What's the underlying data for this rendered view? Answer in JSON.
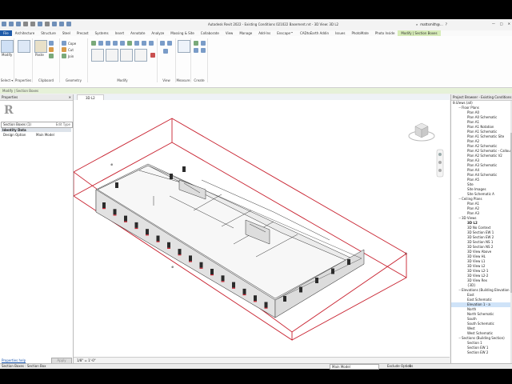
{
  "app": {
    "title": "Autodesk Revit 2022 - Existing Conditions 021022 Basement.rvt - 3D View: 3D L2",
    "user": "mattsmith@..."
  },
  "ribbon": {
    "tabs": [
      "File",
      "Architecture",
      "Structure",
      "Steel",
      "Precast",
      "Systems",
      "Insert",
      "Annotate",
      "Analyze",
      "Massing & Site",
      "Collaborate",
      "View",
      "Manage",
      "Add-Ins",
      "Enscape™",
      "CADtoEarth Addin",
      "Issues",
      "PhotoMate",
      "Photo Inside",
      "Modify | Section Boxes"
    ],
    "panels": {
      "select": {
        "button": "Modify",
        "label": "Select ▾"
      },
      "properties": {
        "label": "Properties"
      },
      "clipboard": {
        "paste": "Paste",
        "items": [
          "Cut",
          "Join"
        ],
        "label": "Clipboard"
      },
      "geometry": {
        "items": [
          "Cope",
          "Cut",
          "Join"
        ],
        "label": "Geometry"
      },
      "modify": {
        "label": "Modify"
      },
      "view": {
        "label": "View"
      },
      "measure": {
        "label": "Measure"
      },
      "create": {
        "label": "Create"
      }
    },
    "context_label": "Modify | Section Boxes"
  },
  "properties": {
    "header": "Properties",
    "type_selector": "Section Boxes (1)",
    "edit_type": "Edit Type",
    "group": "Identity Data",
    "rows": [
      {
        "key": "Design Option",
        "value": "Main Model"
      }
    ],
    "help_link": "Properties help",
    "apply": "Apply"
  },
  "view": {
    "tab": "3D L2",
    "scale": "1/8\" = 1'-0\""
  },
  "browser": {
    "header": "Project Browser - Existing Conditions 0...",
    "items": [
      {
        "label": "Views (all)",
        "level": 0,
        "exp": "−"
      },
      {
        "label": "Floor Plans",
        "level": 1,
        "exp": "−"
      },
      {
        "label": "Plan A0",
        "level": 2
      },
      {
        "label": "Plan A0 Schematic",
        "level": 2
      },
      {
        "label": "Plan A1",
        "level": 2
      },
      {
        "label": "Plan A1 Notation",
        "level": 2
      },
      {
        "label": "Plan A1 Schematic",
        "level": 2
      },
      {
        "label": "Plan A1 Schematic Site",
        "level": 2
      },
      {
        "label": "Plan A2",
        "level": 2
      },
      {
        "label": "Plan A2 Schematic",
        "level": 2
      },
      {
        "label": "Plan A2 Schematic - Callou",
        "level": 2
      },
      {
        "label": "Plan A2 Schematic V2",
        "level": 2
      },
      {
        "label": "Plan A3",
        "level": 2
      },
      {
        "label": "Plan A3 Schematic",
        "level": 2
      },
      {
        "label": "Plan A4",
        "level": 2
      },
      {
        "label": "Plan A4 Schematic",
        "level": 2
      },
      {
        "label": "Plan A5",
        "level": 2
      },
      {
        "label": "Site",
        "level": 2
      },
      {
        "label": "Site Images",
        "level": 2
      },
      {
        "label": "Site Schematic A",
        "level": 2
      },
      {
        "label": "Ceiling Plans",
        "level": 1,
        "exp": "−"
      },
      {
        "label": "Plan A1",
        "level": 2
      },
      {
        "label": "Plan A2",
        "level": 2
      },
      {
        "label": "Plan A3",
        "level": 2
      },
      {
        "label": "3D Views",
        "level": 1,
        "exp": "−"
      },
      {
        "label": "3D L2",
        "level": 2,
        "bold": true
      },
      {
        "label": "3D No Context",
        "level": 2
      },
      {
        "label": "3D Section EW 1",
        "level": 2
      },
      {
        "label": "3D Section EW 2",
        "level": 2
      },
      {
        "label": "3D Section NS 1",
        "level": 2
      },
      {
        "label": "3D Section NS 2",
        "level": 2
      },
      {
        "label": "3D View Above",
        "level": 2
      },
      {
        "label": "3D View HL",
        "level": 2
      },
      {
        "label": "3D View L1",
        "level": 2
      },
      {
        "label": "3D View L2",
        "level": 2
      },
      {
        "label": "3D View L2-1",
        "level": 2
      },
      {
        "label": "3D View L2-2",
        "level": 2
      },
      {
        "label": "3D View Rex",
        "level": 2
      },
      {
        "label": "{3D}",
        "level": 2
      },
      {
        "label": "Elevations (Building Elevation C",
        "level": 1,
        "exp": "−"
      },
      {
        "label": "East",
        "level": 2
      },
      {
        "label": "East Schematic",
        "level": 2
      },
      {
        "label": "Elevation 1 - a",
        "level": 2,
        "sel": true
      },
      {
        "label": "North",
        "level": 2
      },
      {
        "label": "North Schematic",
        "level": 2
      },
      {
        "label": "South",
        "level": 2
      },
      {
        "label": "South Schematic",
        "level": 2
      },
      {
        "label": "West",
        "level": 2
      },
      {
        "label": "West Schematic",
        "level": 2
      },
      {
        "label": "Sections (Building Section)",
        "level": 1,
        "exp": "−"
      },
      {
        "label": "Section 1",
        "level": 2
      },
      {
        "label": "Section EW 1",
        "level": 2
      },
      {
        "label": "Section EW 2",
        "level": 2
      }
    ]
  },
  "status": {
    "left": "Section Boxes : Section Box",
    "zero": ":0",
    "design_option": "Main Model",
    "exclude": "Exclude Options"
  },
  "colors": {
    "section_box": "#c8202e",
    "file_tab": "#1e5aa8",
    "context_tab": "#d7ecb8"
  }
}
